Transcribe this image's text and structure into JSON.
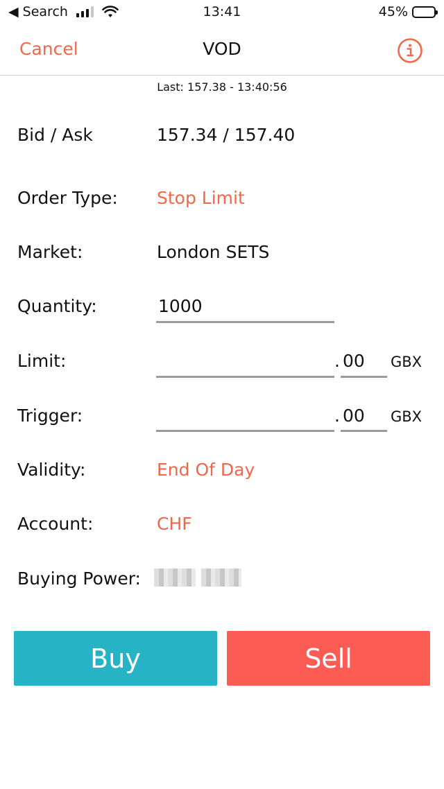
{
  "status_bar": {
    "back_label": "◀ Search",
    "time": "13:41",
    "battery": "45%",
    "battery_level": 0.45
  },
  "nav": {
    "cancel": "Cancel",
    "title": "VOD",
    "info_icon": "info-icon"
  },
  "last": "Last: 157.38 - 13:40:56",
  "rows": {
    "bid_ask_label": "Bid / Ask",
    "bid_ask_value": "157.34 / 157.40",
    "order_type_label": "Order Type:",
    "order_type_value": "Stop Limit",
    "market_label": "Market:",
    "market_value": "London SETS",
    "quantity_label": "Quantity:",
    "quantity_value": "1000",
    "limit_label": "Limit:",
    "limit_dot": ".",
    "limit_decimal": "00",
    "limit_unit": "GBX",
    "trigger_label": "Trigger:",
    "trigger_dot": ".",
    "trigger_decimal": "00",
    "trigger_unit": "GBX",
    "validity_label": "Validity:",
    "validity_value": "End Of Day",
    "account_label": "Account:",
    "account_value": "CHF",
    "buying_power_label": "Buying Power:"
  },
  "buttons": {
    "buy": "Buy",
    "sell": "Sell"
  },
  "colors": {
    "accent": "#f2674a",
    "buy": "#26b3c6",
    "sell": "#fd5c55"
  }
}
